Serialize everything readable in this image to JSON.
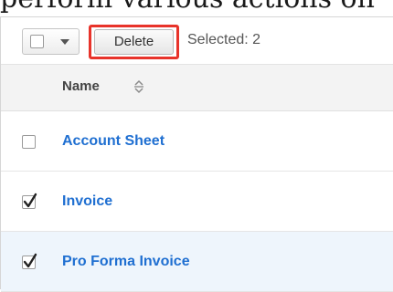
{
  "caption": "perform various actions on",
  "toolbar": {
    "delete_label": "Delete",
    "selected_text": "Selected: 2"
  },
  "table": {
    "column_name": "Name",
    "rows": [
      {
        "label": "Account Sheet",
        "checked": false,
        "highlighted": false
      },
      {
        "label": "Invoice",
        "checked": true,
        "highlighted": false
      },
      {
        "label": "Pro Forma Invoice",
        "checked": true,
        "highlighted": true
      }
    ]
  },
  "colors": {
    "highlight_box": "#e8332a",
    "link": "#1f6fd1",
    "row_highlight": "#eef5fc",
    "header_bg": "#f3f3f3"
  }
}
